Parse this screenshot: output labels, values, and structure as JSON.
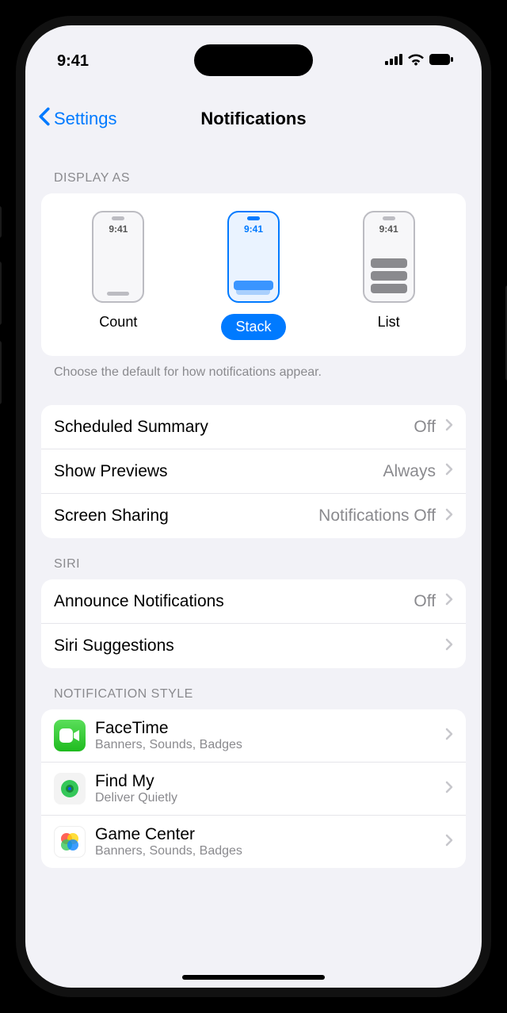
{
  "status": {
    "time": "9:41"
  },
  "nav": {
    "back": "Settings",
    "title": "Notifications"
  },
  "display_as": {
    "header": "DISPLAY AS",
    "options": [
      {
        "label": "Count",
        "preview_time": "9:41",
        "selected": false
      },
      {
        "label": "Stack",
        "preview_time": "9:41",
        "selected": true
      },
      {
        "label": "List",
        "preview_time": "9:41",
        "selected": false
      }
    ],
    "footer": "Choose the default for how notifications appear."
  },
  "general": {
    "rows": [
      {
        "label": "Scheduled Summary",
        "value": "Off"
      },
      {
        "label": "Show Previews",
        "value": "Always"
      },
      {
        "label": "Screen Sharing",
        "value": "Notifications Off"
      }
    ]
  },
  "siri": {
    "header": "SIRI",
    "rows": [
      {
        "label": "Announce Notifications",
        "value": "Off"
      },
      {
        "label": "Siri Suggestions",
        "value": ""
      }
    ]
  },
  "style": {
    "header": "NOTIFICATION STYLE",
    "apps": [
      {
        "name": "FaceTime",
        "sub": "Banners, Sounds, Badges",
        "icon": "facetime"
      },
      {
        "name": "Find My",
        "sub": "Deliver Quietly",
        "icon": "findmy"
      },
      {
        "name": "Game Center",
        "sub": "Banners, Sounds, Badges",
        "icon": "gamecenter"
      }
    ]
  }
}
